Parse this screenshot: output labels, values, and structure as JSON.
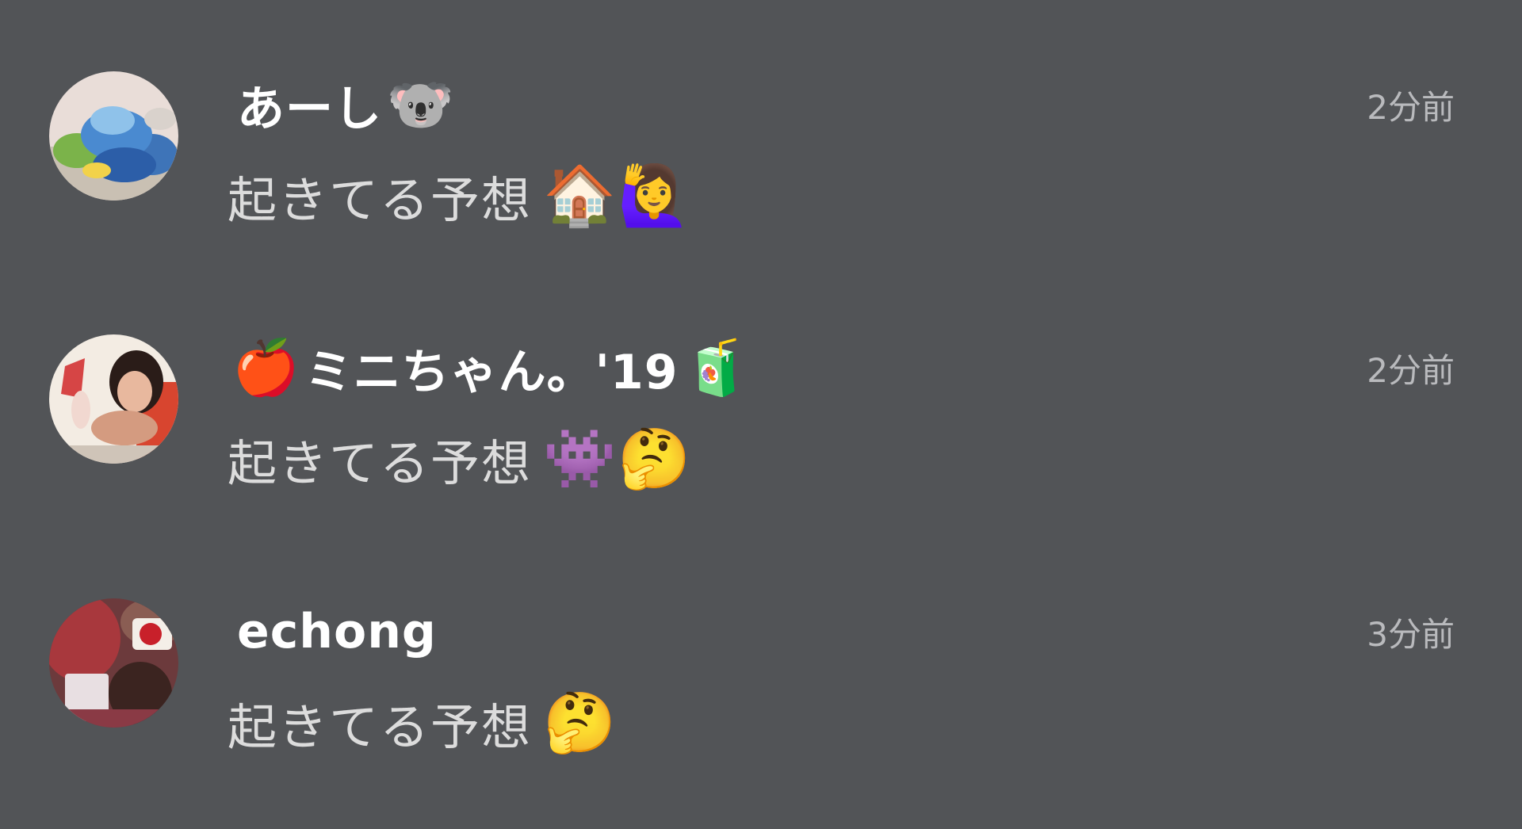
{
  "comments": [
    {
      "username": "あーし",
      "username_prefix_emoji": "",
      "username_suffix_emoji": "🐨",
      "message": "起きてる予想",
      "message_emojis": "🏠🙋‍♀️",
      "timestamp": "2分前"
    },
    {
      "username": "ミニちゃん。'19",
      "username_prefix_emoji": "🍎",
      "username_suffix_emoji": "🧃",
      "message": "起きてる予想",
      "message_emojis": "👾🤔",
      "timestamp": "2分前"
    },
    {
      "username": "echong",
      "username_prefix_emoji": "",
      "username_suffix_emoji": "",
      "message": "起きてる予想",
      "message_emojis": "🤔",
      "timestamp": "3分前"
    }
  ],
  "colors": {
    "background": "#525457",
    "username": "#ffffff",
    "message": "#dcdcdc",
    "timestamp": "#b9babd"
  }
}
